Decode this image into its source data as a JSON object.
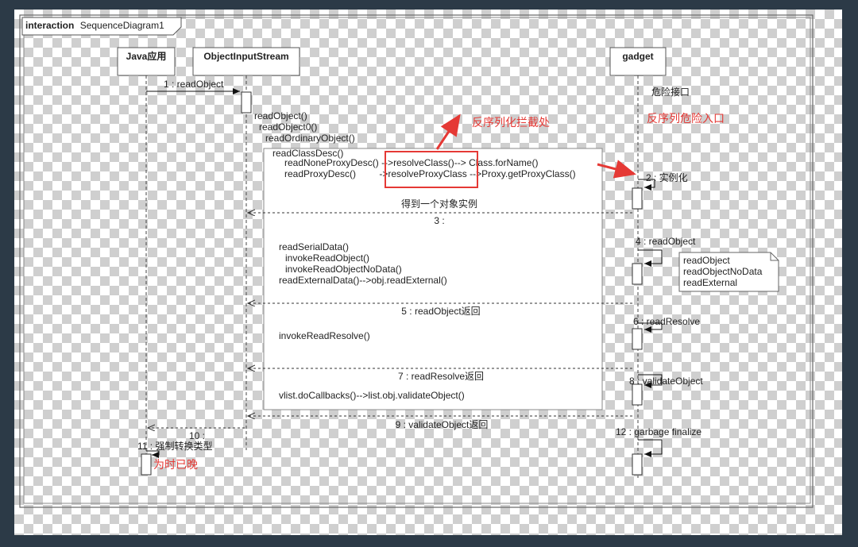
{
  "frame": {
    "keyword": "interaction",
    "name": "SequenceDiagram1"
  },
  "lifelines": [
    {
      "id": "java",
      "label": "Java应用"
    },
    {
      "id": "ois",
      "label": "ObjectInputStream"
    },
    {
      "id": "gadget",
      "label": "gadget"
    }
  ],
  "messages": {
    "m1": "1 : readObject",
    "m2": "2 : 实例化",
    "m3": "3 :",
    "m3_caption": "得到一个对象实例",
    "m4": "4 : readObject",
    "m5": "5 : readObject返回",
    "m6": "6 : readResolve",
    "m7": "7 : readResolve返回",
    "m8": "8 : validateObject",
    "m9": "9 : validateObject返回",
    "m10": "10 :",
    "m11": "11 : 强制转换类型",
    "m12": "12 : garbage finalize"
  },
  "call_trace": {
    "top": [
      "readObject()",
      "readObject0()",
      "readOrdinaryObject()",
      "readClassDesc()"
    ],
    "nonproxy_prefix": "readNoneProxyDesc()",
    "nonproxy_hook": "-->resolveClass()-->",
    "nonproxy_suffix": "Class.forName()",
    "proxy_prefix": "readProxyDesc()",
    "proxy_hook": "->resolveProxyClass",
    "proxy_suffix": "-->Proxy.getProxyClass()",
    "serial": [
      "readSerialData()",
      "invokeReadObject()",
      "invokeReadObjectNoData()",
      "readExternalData()-->obj.readExternal()"
    ],
    "resolve": "invokeReadResolve()",
    "callbacks": "vlist.doCallbacks()-->list.obj.validateObject()"
  },
  "note": [
    "readObject",
    "readObjectNoData",
    "readExternal"
  ],
  "annotations": {
    "danger_interface": "危险接口",
    "deser_intercept": "反序列化拦截处",
    "deser_danger_entry": "反序列危险入口",
    "too_late": "为时已晚"
  },
  "colors": {
    "accent": "#e53935"
  }
}
